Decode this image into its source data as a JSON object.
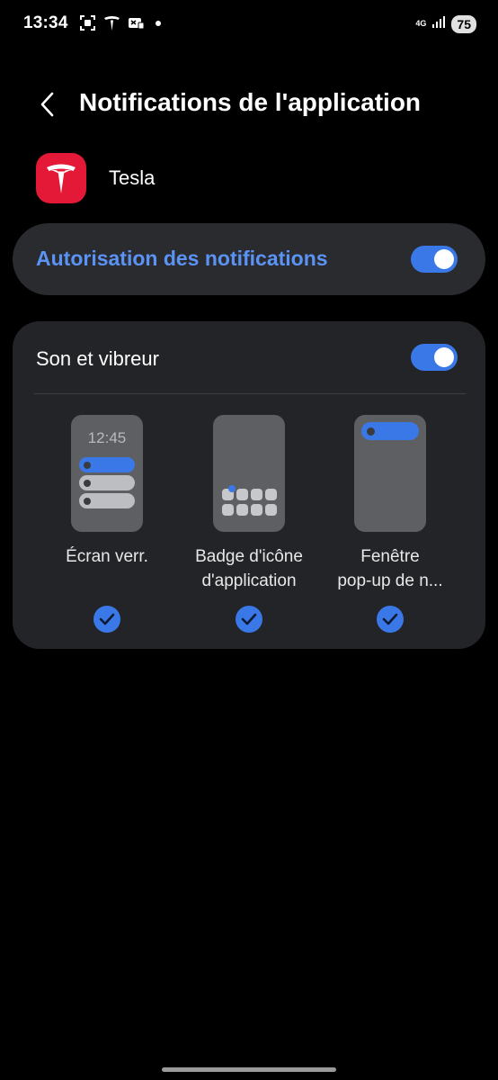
{
  "status_bar": {
    "time": "13:34",
    "network": "4G",
    "battery": "75"
  },
  "header": {
    "title": "Notifications de l'application"
  },
  "app": {
    "name": "Tesla",
    "icon_color": "#e31937"
  },
  "main_toggle": {
    "label": "Autorisation des notifications",
    "enabled": true
  },
  "sound_section": {
    "label": "Son et vibreur",
    "enabled": true,
    "options": [
      {
        "line1": "Écran verr.",
        "line2": "",
        "preview_time": "12:45",
        "checked": true
      },
      {
        "line1": "Badge d'icône",
        "line2": "d'application",
        "checked": true
      },
      {
        "line1": "Fenêtre",
        "line2": "pop-up de n...",
        "checked": true
      }
    ]
  },
  "colors": {
    "accent": "#3b78e7",
    "accent_text": "#5b93f5",
    "background": "#000000",
    "card": "#2a2b2f"
  }
}
